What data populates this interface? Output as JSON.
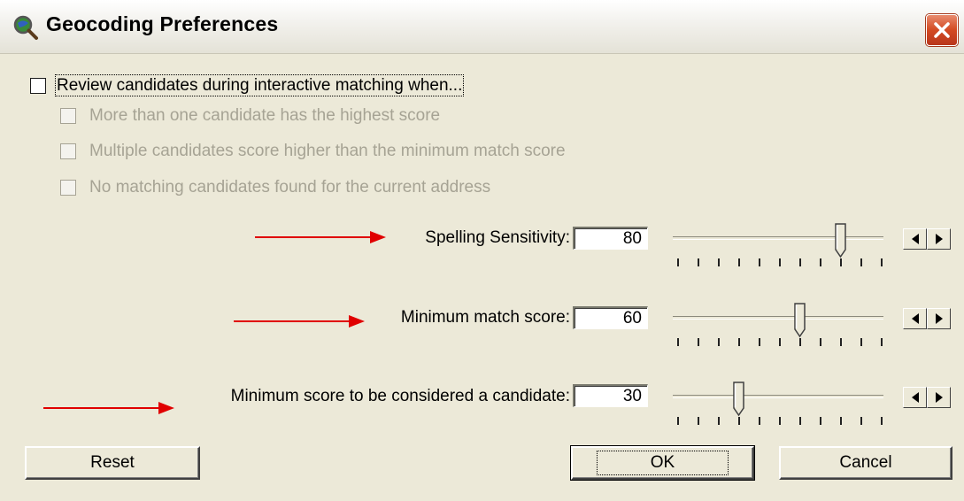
{
  "window": {
    "title": "Geocoding Preferences",
    "close_icon": "close-icon",
    "app_icon": "magnifier-globe-icon"
  },
  "review": {
    "main_label": "Review candidates during interactive matching when...",
    "checked": false,
    "options": [
      {
        "label": "More than one candidate has the highest score",
        "checked": false,
        "enabled": false
      },
      {
        "label": "Multiple candidates score higher than the minimum match score",
        "checked": false,
        "enabled": false
      },
      {
        "label": "No matching candidates found for the current address",
        "checked": false,
        "enabled": false
      }
    ]
  },
  "settings": {
    "spelling": {
      "label": "Spelling Sensitivity:",
      "value": "80",
      "level": 80
    },
    "min_match": {
      "label": "Minimum match score:",
      "value": "60",
      "level": 60
    },
    "min_candidate": {
      "label": "Minimum score to be considered a candidate:",
      "value": "30",
      "level": 30
    }
  },
  "buttons": {
    "reset": "Reset",
    "ok": "OK",
    "cancel": "Cancel"
  },
  "colors": {
    "annotation_arrow": "#e00000",
    "close_button": "#d34a22"
  }
}
